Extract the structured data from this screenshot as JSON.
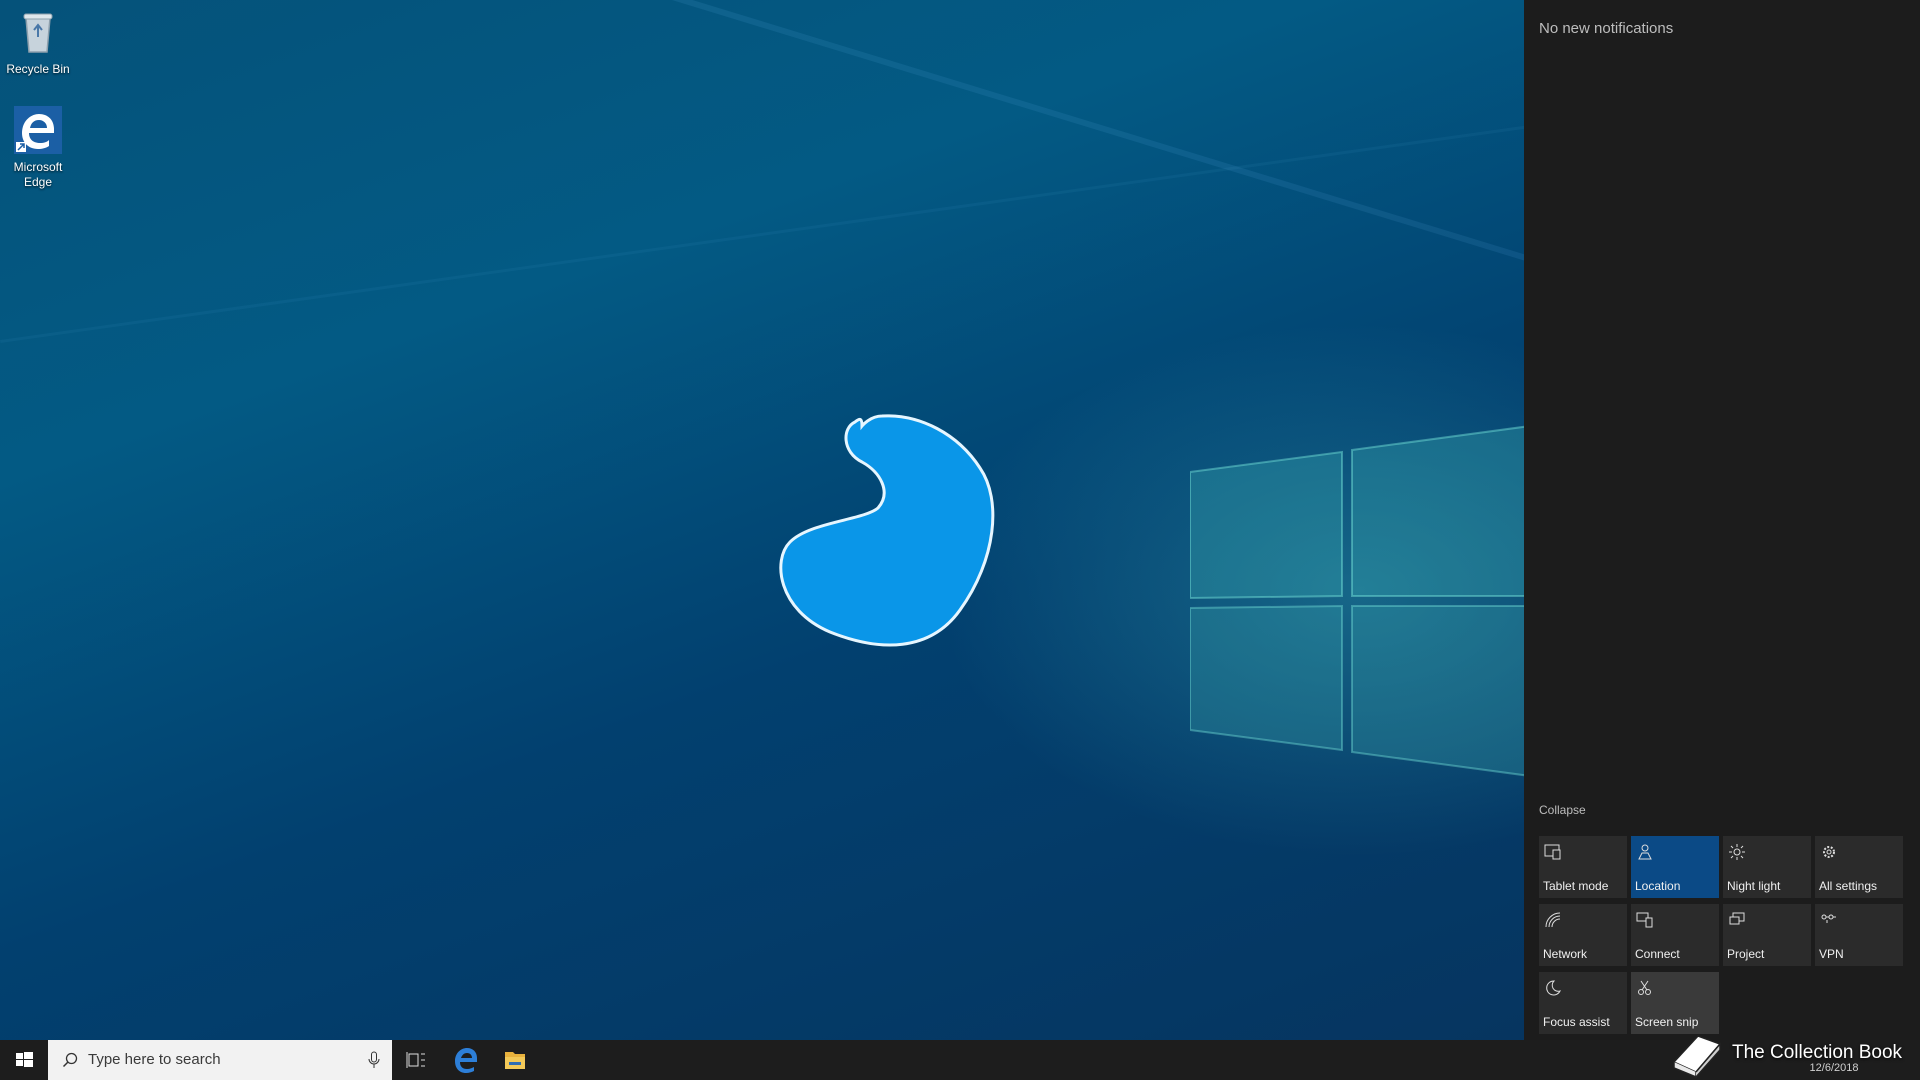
{
  "desktop": {
    "icons": [
      {
        "label": "Recycle Bin",
        "icon": "recycle-bin-icon"
      },
      {
        "label": "Microsoft Edge",
        "icon": "edge-icon"
      }
    ],
    "center_graphic": "blue-blob-shape"
  },
  "action_center": {
    "notifications_text": "No new notifications",
    "collapse_label": "Collapse",
    "quick_actions": [
      {
        "label": "Tablet mode",
        "icon": "tablet-mode-icon",
        "state": "off"
      },
      {
        "label": "Location",
        "icon": "location-icon",
        "state": "on"
      },
      {
        "label": "Night light",
        "icon": "night-light-icon",
        "state": "off"
      },
      {
        "label": "All settings",
        "icon": "gear-icon",
        "state": "off"
      },
      {
        "label": "Network",
        "icon": "network-icon",
        "state": "off"
      },
      {
        "label": "Connect",
        "icon": "connect-icon",
        "state": "off"
      },
      {
        "label": "Project",
        "icon": "project-icon",
        "state": "off"
      },
      {
        "label": "VPN",
        "icon": "vpn-icon",
        "state": "off"
      },
      {
        "label": "Focus assist",
        "icon": "moon-icon",
        "state": "off"
      },
      {
        "label": "Screen snip",
        "icon": "scissors-icon",
        "state": "hover"
      }
    ],
    "accent_color": "#0b4a86"
  },
  "taskbar": {
    "search_placeholder": "Type here to search",
    "pinned": [
      "task-view-icon",
      "edge-icon",
      "file-explorer-icon"
    ],
    "date": "12/6/2018"
  },
  "watermark": {
    "text": "The Collection Book"
  }
}
